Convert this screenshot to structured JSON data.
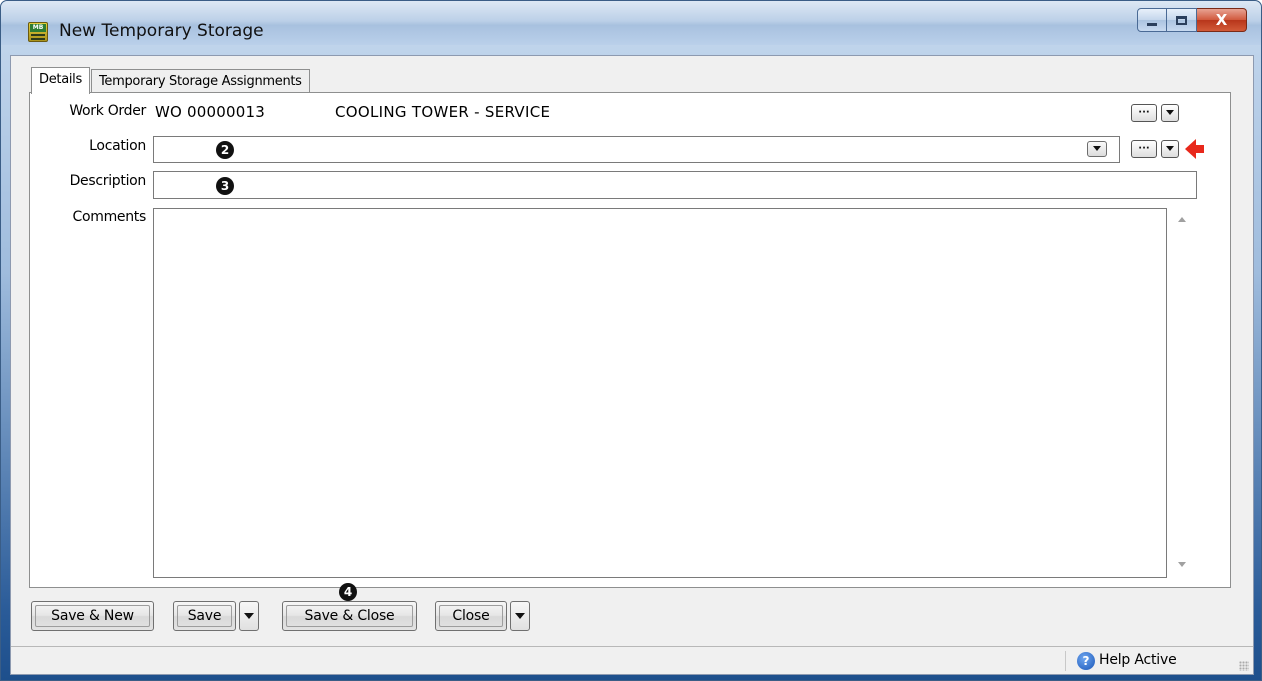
{
  "window": {
    "title": "New Temporary Storage",
    "icon": "app-mb-icon",
    "icon_text": "MB",
    "close_glyph": "X"
  },
  "tabs": [
    {
      "label": "Details",
      "active": true
    },
    {
      "label": "Temporary Storage Assignments",
      "active": false
    }
  ],
  "form": {
    "work_order": {
      "label": "Work Order",
      "number": "WO 00000013",
      "description": "COOLING TOWER - SERVICE"
    },
    "location": {
      "label": "Location",
      "value": "",
      "marker": "2"
    },
    "description": {
      "label": "Description",
      "value": "",
      "marker": "3"
    },
    "comments": {
      "label": "Comments",
      "value": ""
    }
  },
  "lookup_button_label": "···",
  "buttons": {
    "save_new": "Save & New",
    "save": "Save",
    "save_close": "Save & Close",
    "save_close_marker": "4",
    "close": "Close"
  },
  "status": {
    "help_icon_glyph": "?",
    "help_label": "Help",
    "active_label": "Active"
  },
  "colors": {
    "arrow": "#e8281b",
    "title_bar": "#bcd0e8",
    "close_button": "#c94a2e"
  }
}
